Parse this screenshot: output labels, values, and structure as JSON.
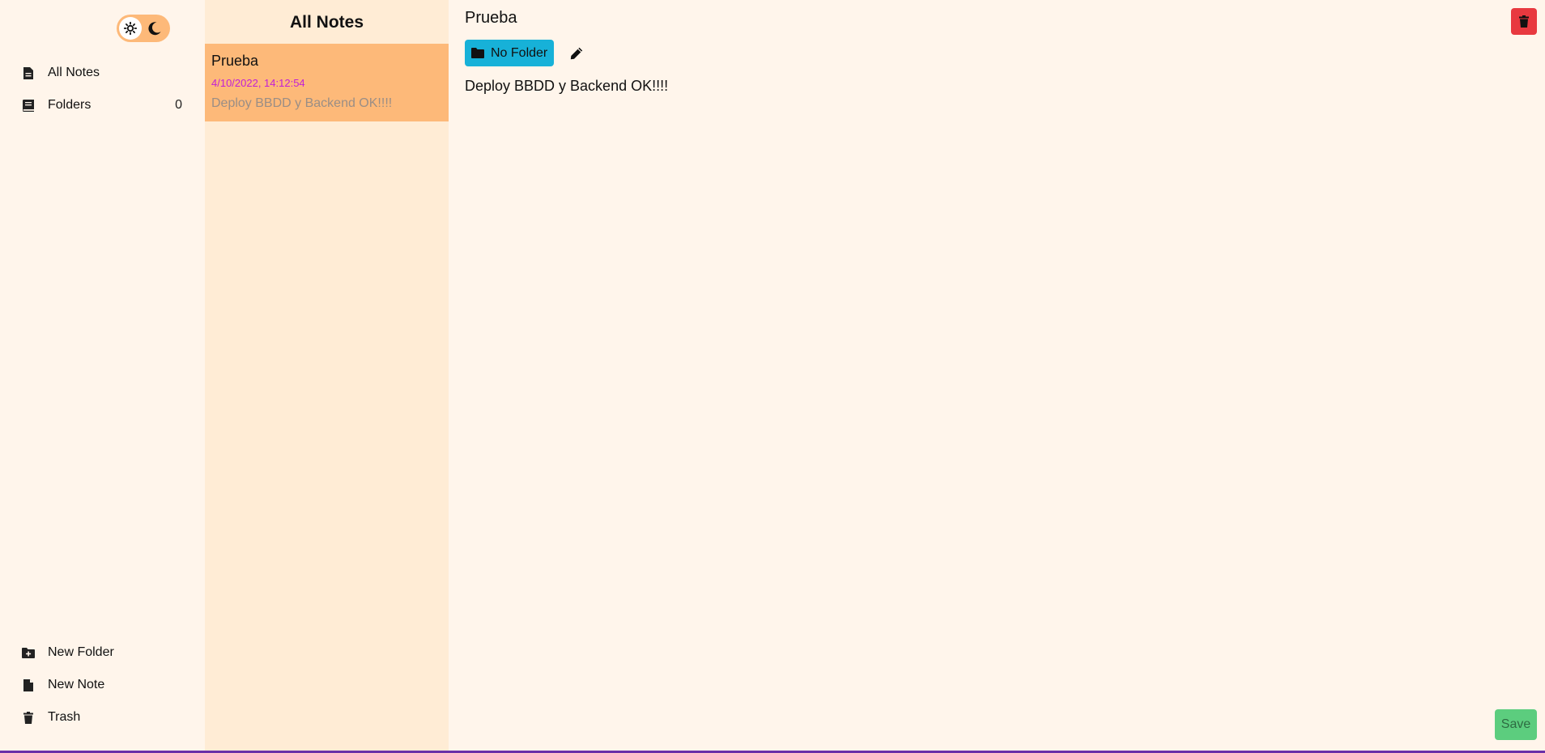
{
  "sidebar": {
    "theme_toggle": {
      "mode": "light",
      "light_icon": "sun-icon",
      "dark_icon": "moon-icon"
    },
    "top_items": [
      {
        "label": "All Notes",
        "icon": "file-text-icon"
      },
      {
        "label": "Folders",
        "icon": "book-icon",
        "count": "0"
      }
    ],
    "bottom_items": [
      {
        "label": "New Folder",
        "icon": "folder-plus-icon"
      },
      {
        "label": "New Note",
        "icon": "file-icon"
      },
      {
        "label": "Trash",
        "icon": "trash-icon"
      }
    ]
  },
  "notes_list": {
    "title": "All Notes",
    "notes": [
      {
        "title": "Prueba",
        "date": "4/10/2022, 14:12:54",
        "excerpt": "Deploy BBDD y Backend OK!!!!"
      }
    ]
  },
  "editor": {
    "title": "Prueba",
    "folder_label": "No Folder",
    "body": "Deploy BBDD y Backend OK!!!!",
    "save_label": "Save"
  },
  "colors": {
    "background": "#fff5eb",
    "notes_panel": "#ffecd5",
    "accent_orange": "#fdb979",
    "folder_button": "#17b1d8",
    "delete_button": "#e8393f",
    "save_button": "#5ccd7e",
    "date_text": "#c21fd6"
  }
}
